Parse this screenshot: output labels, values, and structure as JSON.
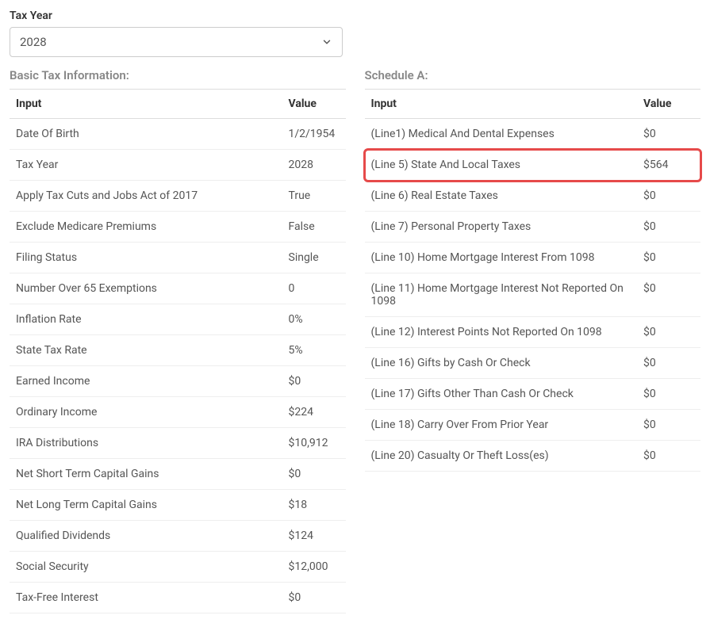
{
  "tax_year_field": {
    "label": "Tax Year",
    "value": "2028"
  },
  "basic": {
    "title": "Basic Tax Information:",
    "columns": {
      "input": "Input",
      "value": "Value"
    },
    "rows": [
      {
        "input": "Date Of Birth",
        "value": "1/2/1954"
      },
      {
        "input": "Tax Year",
        "value": "2028"
      },
      {
        "input": "Apply Tax Cuts and Jobs Act of 2017",
        "value": "True"
      },
      {
        "input": "Exclude Medicare Premiums",
        "value": "False"
      },
      {
        "input": "Filing Status",
        "value": "Single"
      },
      {
        "input": "Number Over 65 Exemptions",
        "value": "0"
      },
      {
        "input": "Inflation Rate",
        "value": "0%"
      },
      {
        "input": "State Tax Rate",
        "value": "5%"
      },
      {
        "input": "Earned Income",
        "value": "$0"
      },
      {
        "input": "Ordinary Income",
        "value": "$224"
      },
      {
        "input": "IRA Distributions",
        "value": "$10,912"
      },
      {
        "input": "Net Short Term Capital Gains",
        "value": "$0"
      },
      {
        "input": "Net Long Term Capital Gains",
        "value": "$18"
      },
      {
        "input": "Qualified Dividends",
        "value": "$124"
      },
      {
        "input": "Social Security",
        "value": "$12,000"
      },
      {
        "input": "Tax-Free Interest",
        "value": "$0"
      }
    ]
  },
  "scheduleA": {
    "title": "Schedule A:",
    "columns": {
      "input": "Input",
      "value": "Value"
    },
    "rows": [
      {
        "input": "(Line1) Medical And Dental Expenses",
        "value": "$0",
        "highlight": false
      },
      {
        "input": "(Line 5) State And Local Taxes",
        "value": "$564",
        "highlight": true
      },
      {
        "input": "(Line 6) Real Estate Taxes",
        "value": "$0",
        "highlight": false
      },
      {
        "input": "(Line 7) Personal Property Taxes",
        "value": "$0",
        "highlight": false
      },
      {
        "input": "(Line 10) Home Mortgage Interest From 1098",
        "value": "$0",
        "highlight": false
      },
      {
        "input": "(Line 11) Home Mortgage Interest Not Reported On 1098",
        "value": "$0",
        "highlight": false
      },
      {
        "input": "(Line 12) Interest Points Not Reported On 1098",
        "value": "$0",
        "highlight": false
      },
      {
        "input": "(Line 16) Gifts by Cash Or Check",
        "value": "$0",
        "highlight": false
      },
      {
        "input": "(Line 17) Gifts Other Than Cash Or Check",
        "value": "$0",
        "highlight": false
      },
      {
        "input": "(Line 18) Carry Over From Prior Year",
        "value": "$0",
        "highlight": false
      },
      {
        "input": "(Line 20) Casualty Or Theft Loss(es)",
        "value": "$0",
        "highlight": false
      }
    ]
  }
}
